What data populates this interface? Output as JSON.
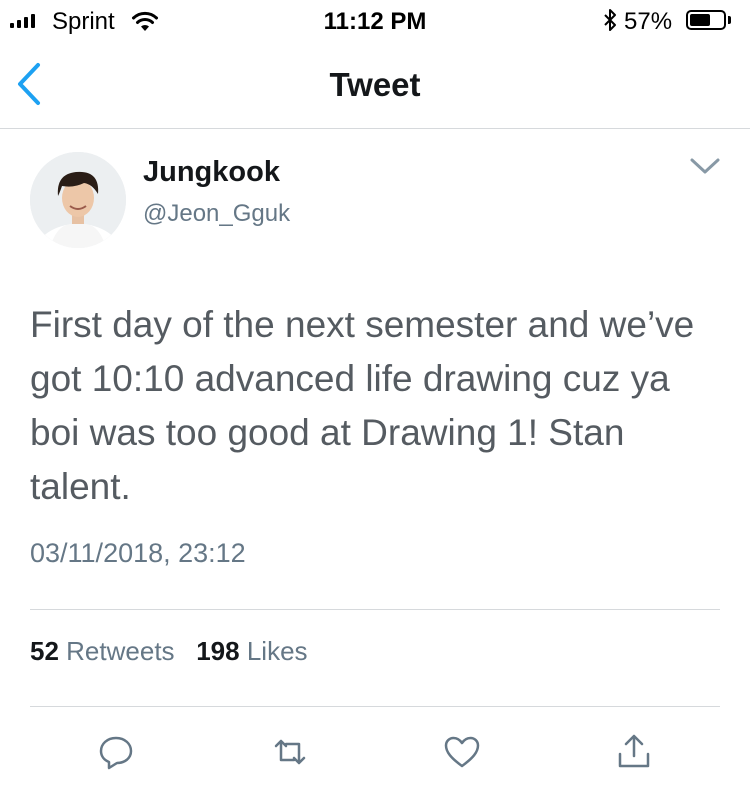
{
  "status_bar": {
    "carrier": "Sprint",
    "time": "11:12 PM",
    "battery_percent": "57%",
    "battery_level": 0.57
  },
  "nav": {
    "title": "Tweet",
    "back_icon": "chevron-left-icon"
  },
  "tweet": {
    "author_name": "Jungkook",
    "author_handle": "@Jeon_Gguk",
    "text": "First day of the next semester and we’ve got 10:10 advanced life drawing cuz ya boi was too good at Drawing 1! Stan talent.",
    "timestamp": "03/11/2018, 23:12",
    "retweet_count": "52",
    "retweet_label": "Retweets",
    "like_count": "198",
    "like_label": "Likes"
  },
  "actions": [
    "reply-icon",
    "retweet-icon",
    "like-icon",
    "share-icon"
  ],
  "colors": {
    "accent": "#1da1f2",
    "text_primary": "#14171a",
    "text_secondary": "#657786",
    "icon": "#657786",
    "divider": "#d6d9dc"
  }
}
